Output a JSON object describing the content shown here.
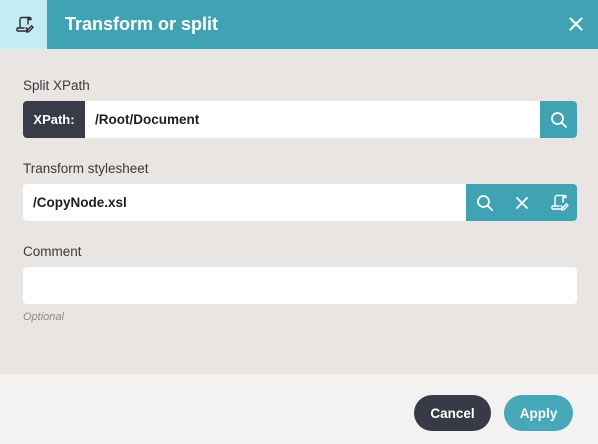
{
  "dialog": {
    "title": "Transform or split",
    "icon": "script-edit-icon",
    "close_icon": "close-icon"
  },
  "split_xpath": {
    "label": "Split XPath",
    "prefix": "XPath:",
    "value": "/Root/Document",
    "search_icon": "search-icon"
  },
  "transform_stylesheet": {
    "label": "Transform stylesheet",
    "value": "/CopyNode.xsl",
    "icons": [
      "search-icon",
      "close-icon",
      "stylesheet-edit-icon"
    ]
  },
  "comment": {
    "label": "Comment",
    "value": "",
    "hint": "Optional"
  },
  "footer": {
    "cancel_label": "Cancel",
    "apply_label": "Apply"
  },
  "colors": {
    "accent": "#3fa3b3",
    "header_icon_bg": "#c3ecf5",
    "dark": "#393a48",
    "body_bg": "#e9e5e2",
    "footer_bg": "#f3f2f1"
  }
}
